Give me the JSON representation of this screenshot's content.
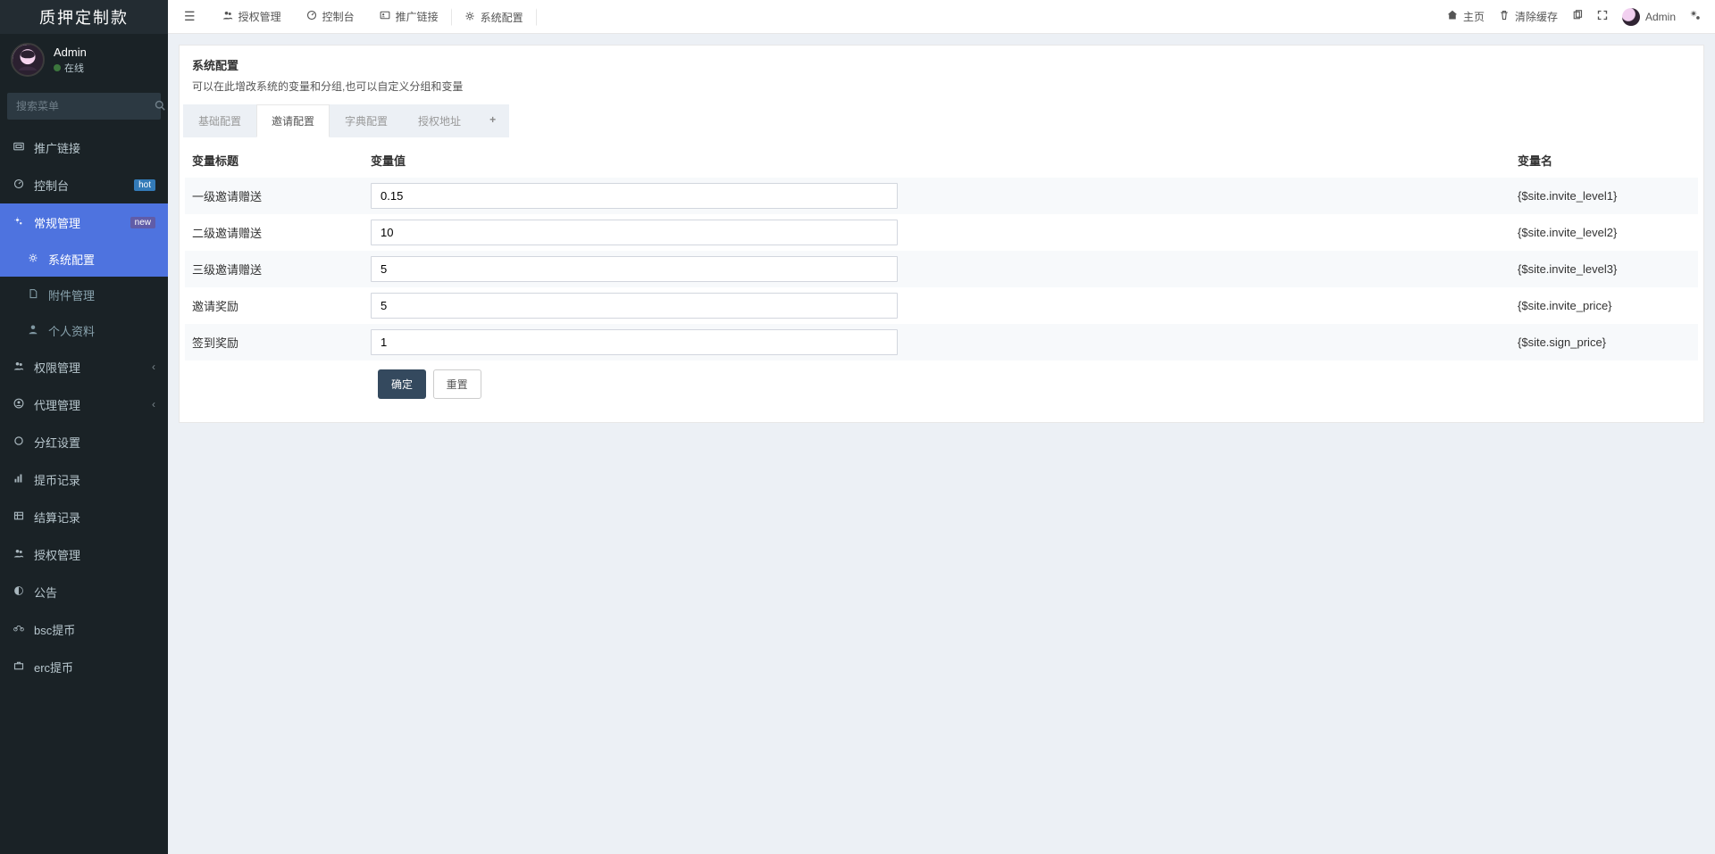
{
  "brand": "质押定制款",
  "user": {
    "name": "Admin",
    "status": "在线"
  },
  "search_placeholder": "搜索菜单",
  "sidebar": [
    {
      "icon": "link",
      "label": "推广链接"
    },
    {
      "icon": "dash",
      "label": "控制台",
      "badge": "hot",
      "badge_kind": "hot"
    },
    {
      "icon": "cogs",
      "label": "常规管理",
      "badge": "new",
      "badge_kind": "new",
      "children": [
        {
          "label": "系统配置",
          "active": true,
          "icon": "cog"
        },
        {
          "label": "附件管理",
          "icon": "file"
        },
        {
          "label": "个人资料",
          "icon": "user"
        }
      ]
    },
    {
      "icon": "users",
      "label": "权限管理",
      "expandable": true
    },
    {
      "icon": "usercir",
      "label": "代理管理",
      "expandable": true
    },
    {
      "icon": "circle",
      "label": "分红设置"
    },
    {
      "icon": "bars",
      "label": "提币记录"
    },
    {
      "icon": "list",
      "label": "结算记录"
    },
    {
      "icon": "users",
      "label": "授权管理"
    },
    {
      "icon": "half",
      "label": "公告"
    },
    {
      "icon": "bike",
      "label": "bsc提币"
    },
    {
      "icon": "case",
      "label": "erc提币"
    }
  ],
  "top_tabs": [
    {
      "icon": "users",
      "label": "授权管理"
    },
    {
      "icon": "dash",
      "label": "控制台"
    },
    {
      "icon": "idcard",
      "label": "推广链接"
    },
    {
      "icon": "cog",
      "label": "系统配置",
      "active": true
    }
  ],
  "top_right": {
    "home": "主页",
    "cleancache": "清除缓存",
    "username": "Admin"
  },
  "panel": {
    "title": "系统配置",
    "subtitle": "可以在此增改系统的变量和分组,也可以自定义分组和变量"
  },
  "config_tabs": [
    "基础配置",
    "邀请配置",
    "字典配置",
    "授权地址"
  ],
  "config_tab_active": 1,
  "columns": {
    "title": "变量标题",
    "value": "变量值",
    "var": "变量名"
  },
  "rows": [
    {
      "title": "一级邀请赠送",
      "value": "0.15",
      "var": "{$site.invite_level1}"
    },
    {
      "title": "二级邀请赠送",
      "value": "10",
      "var": "{$site.invite_level2}"
    },
    {
      "title": "三级邀请赠送",
      "value": "5",
      "var": "{$site.invite_level3}"
    },
    {
      "title": "邀请奖励",
      "value": "5",
      "var": "{$site.invite_price}"
    },
    {
      "title": "签到奖励",
      "value": "1",
      "var": "{$site.sign_price}"
    }
  ],
  "buttons": {
    "ok": "确定",
    "reset": "重置"
  }
}
